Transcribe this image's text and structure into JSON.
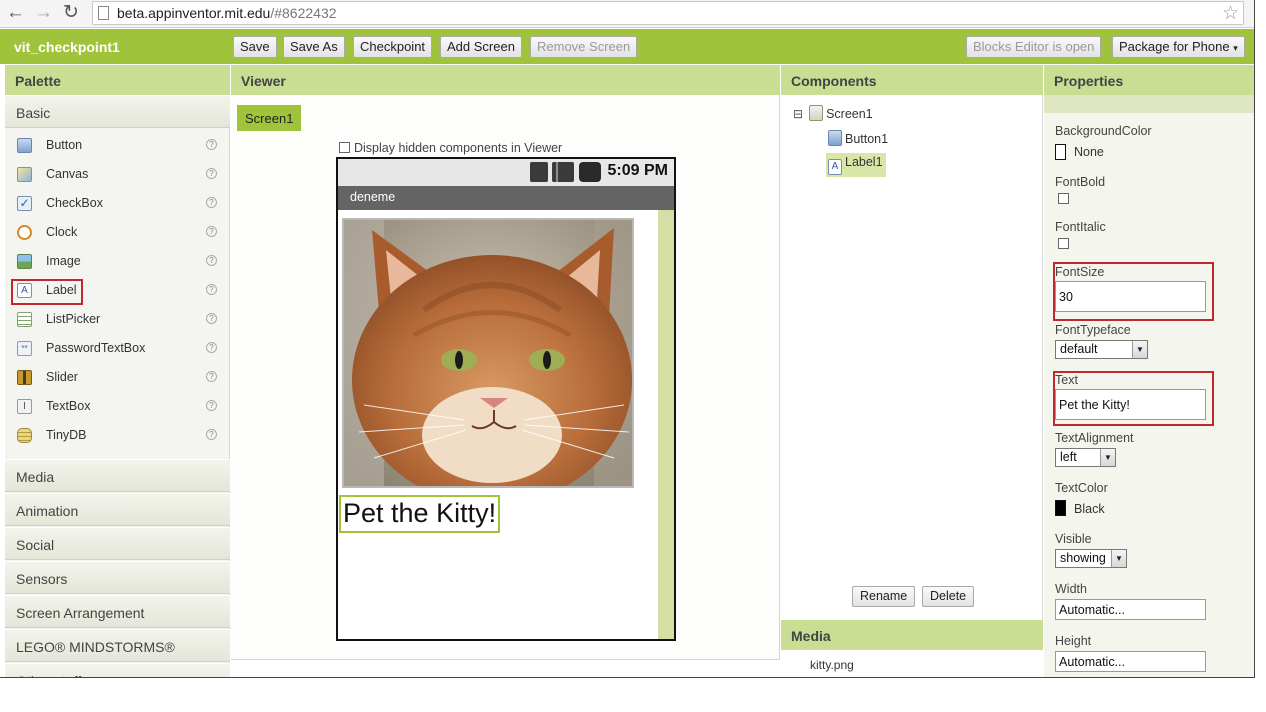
{
  "browser": {
    "url_host": "beta.appinventor.mit.edu",
    "url_rest": "/#8622432"
  },
  "toolbar": {
    "project_name": "vit_checkpoint1",
    "save": "Save",
    "save_as": "Save As",
    "checkpoint": "Checkpoint",
    "add_screen": "Add Screen",
    "remove_screen": "Remove Screen",
    "blocks_editor": "Blocks Editor is open",
    "package": "Package for Phone",
    "package_arrow": "▾"
  },
  "headers": {
    "palette": "Palette",
    "viewer": "Viewer",
    "components": "Components",
    "properties": "Properties",
    "media": "Media"
  },
  "palette": {
    "basic_label": "Basic",
    "items": [
      {
        "label": "Button",
        "icon": "button-icon"
      },
      {
        "label": "Canvas",
        "icon": "canvas-icon"
      },
      {
        "label": "CheckBox",
        "icon": "checkbox-icon"
      },
      {
        "label": "Clock",
        "icon": "clock-icon"
      },
      {
        "label": "Image",
        "icon": "image-icon"
      },
      {
        "label": "Label",
        "icon": "label-icon"
      },
      {
        "label": "ListPicker",
        "icon": "listpicker-icon"
      },
      {
        "label": "PasswordTextBox",
        "icon": "password-icon"
      },
      {
        "label": "Slider",
        "icon": "slider-icon"
      },
      {
        "label": "TextBox",
        "icon": "textbox-icon"
      },
      {
        "label": "TinyDB",
        "icon": "tinydb-icon"
      }
    ],
    "help_glyph": "?",
    "groups": [
      "Media",
      "Animation",
      "Social",
      "Sensors",
      "Screen Arrangement",
      "LEGO® MINDSTORMS®",
      "Other stuff"
    ]
  },
  "viewer": {
    "screen_tab": "Screen1",
    "hidden_components_label": "Display hidden components in Viewer",
    "phone": {
      "time": "5:09 PM",
      "title": "deneme",
      "label_text": "Pet the Kitty!"
    }
  },
  "components": {
    "tree": [
      "Screen1",
      "Button1",
      "Label1"
    ],
    "collapse_glyph": "⊟",
    "rename": "Rename",
    "delete": "Delete",
    "media_items": [
      "kitty.png"
    ]
  },
  "properties": {
    "background_color": {
      "name": "BackgroundColor",
      "value": "None"
    },
    "font_bold": {
      "name": "FontBold"
    },
    "font_italic": {
      "name": "FontItalic"
    },
    "font_size": {
      "name": "FontSize",
      "value": "30"
    },
    "font_typeface": {
      "name": "FontTypeface",
      "value": "default"
    },
    "text": {
      "name": "Text",
      "value": "Pet the Kitty!"
    },
    "text_alignment": {
      "name": "TextAlignment",
      "value": "left"
    },
    "text_color": {
      "name": "TextColor",
      "value": "Black"
    },
    "visible": {
      "name": "Visible",
      "value": "showing"
    },
    "width": {
      "name": "Width",
      "value": "Automatic..."
    },
    "height": {
      "name": "Height",
      "value": "Automatic..."
    }
  },
  "colors": {
    "accent_green": "#a0c33c",
    "header_green": "#c9dd93",
    "highlight_red": "#c0282e"
  }
}
